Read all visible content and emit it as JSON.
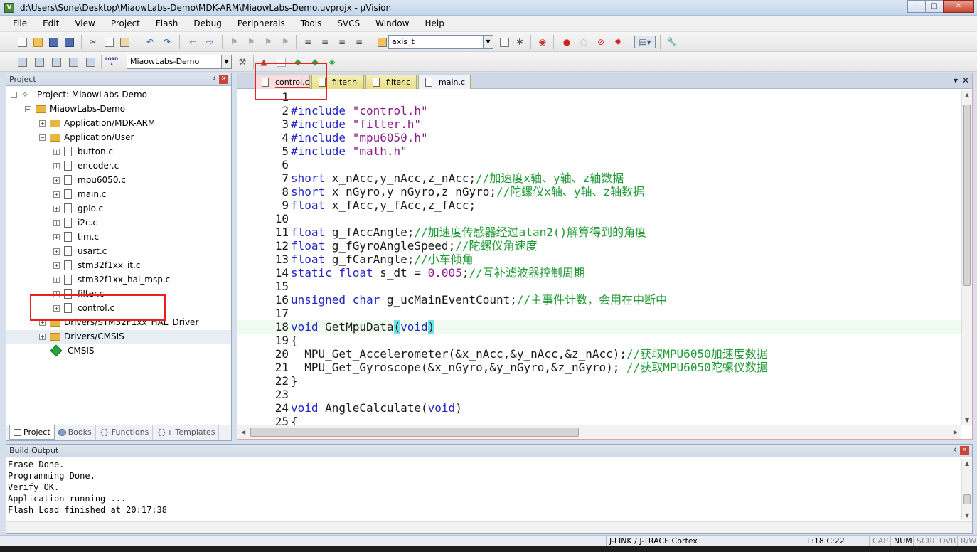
{
  "window": {
    "title": "d:\\Users\\Sone\\Desktop\\MiaowLabs-Demo\\MDK-ARM\\MiaowLabs-Demo.uvprojx - µVision",
    "app_icon": "V",
    "btn_minimize": "–",
    "btn_maximize": "□",
    "btn_close": "✕"
  },
  "menu": [
    "File",
    "Edit",
    "View",
    "Project",
    "Flash",
    "Debug",
    "Peripherals",
    "Tools",
    "SVCS",
    "Window",
    "Help"
  ],
  "toolbar": {
    "find_combo": "axis_t",
    "target_combo": "MiaowLabs-Demo",
    "load_label": "LOAD"
  },
  "project_panel": {
    "title": "Project",
    "pin": "♯",
    "close": "✕",
    "tree": {
      "root": "Project: MiaowLabs-Demo",
      "target": "MiaowLabs-Demo",
      "groups": {
        "mdk": "Application/MDK-ARM",
        "user": "Application/User",
        "hal": "Drivers/STM32F1xx_HAL_Driver",
        "cmsis_group": "Drivers/CMSIS",
        "cmsis": "CMSIS"
      },
      "files": [
        "button.c",
        "encoder.c",
        "mpu6050.c",
        "main.c",
        "gpio.c",
        "i2c.c",
        "tim.c",
        "usart.c",
        "stm32f1xx_it.c",
        "stm32f1xx_hal_msp.c",
        "filter.c",
        "control.c"
      ]
    },
    "tabs": [
      "Project",
      "Books",
      "Functions",
      "Templates"
    ],
    "tab_icons": [
      "",
      "",
      "{}",
      "{}+"
    ]
  },
  "editor": {
    "tabs": [
      "control.c",
      "filter.h",
      "filter.c",
      "main.c"
    ],
    "active_tab": "control.c",
    "tab_menu": "▾",
    "tab_close": "✕",
    "lines": [
      {
        "n": "1",
        "t": ""
      },
      {
        "n": "2",
        "t": "#include \"control.h\""
      },
      {
        "n": "3",
        "t": "#include \"filter.h\""
      },
      {
        "n": "4",
        "t": "#include \"mpu6050.h\""
      },
      {
        "n": "5",
        "t": "#include \"math.h\""
      },
      {
        "n": "6",
        "t": ""
      },
      {
        "n": "7",
        "t": "short x_nAcc,y_nAcc,z_nAcc;//加速度x轴、y轴、z轴数据"
      },
      {
        "n": "8",
        "t": "short x_nGyro,y_nGyro,z_nGyro;//陀螺仪x轴、y轴、z轴数据"
      },
      {
        "n": "9",
        "t": "float x_fAcc,y_fAcc,z_fAcc;"
      },
      {
        "n": "10",
        "t": ""
      },
      {
        "n": "11",
        "t": "float g_fAccAngle;//加速度传感器经过atan2()解算得到的角度"
      },
      {
        "n": "12",
        "t": "float g_fGyroAngleSpeed;//陀螺仪角速度"
      },
      {
        "n": "13",
        "t": "float g_fCarAngle;//小车倾角"
      },
      {
        "n": "14",
        "t": "static float s_dt = 0.005;//互补滤波器控制周期"
      },
      {
        "n": "15",
        "t": ""
      },
      {
        "n": "16",
        "t": "unsigned char g_ucMainEventCount;//主事件计数，会用在中断中"
      },
      {
        "n": "17",
        "t": ""
      },
      {
        "n": "18",
        "t": "void GetMpuData(void)"
      },
      {
        "n": "19",
        "t": "{"
      },
      {
        "n": "20",
        "t": "  MPU_Get_Accelerometer(&x_nAcc,&y_nAcc,&z_nAcc);//获取MPU6050加速度数据"
      },
      {
        "n": "21",
        "t": "  MPU_Get_Gyroscope(&x_nGyro,&y_nGyro,&z_nGyro); //获取MPU6050陀螺仪数据"
      },
      {
        "n": "22",
        "t": "}"
      },
      {
        "n": "23",
        "t": ""
      },
      {
        "n": "24",
        "t": "void AngleCalculate(void)"
      },
      {
        "n": "25",
        "t": "{"
      }
    ],
    "current_line": "18"
  },
  "build_output": {
    "title": "Build Output",
    "lines": [
      "Erase Done.",
      "Programming Done.",
      "Verify OK.",
      "Application running ...",
      "Flash Load finished at 20:17:38"
    ]
  },
  "status": {
    "debugger": "J-LINK / J-TRACE Cortex",
    "position": "L:18 C:22",
    "cap": "CAP",
    "num": "NUM",
    "scrl": "SCRL",
    "ovr": "OVR",
    "rw": "R/W"
  }
}
